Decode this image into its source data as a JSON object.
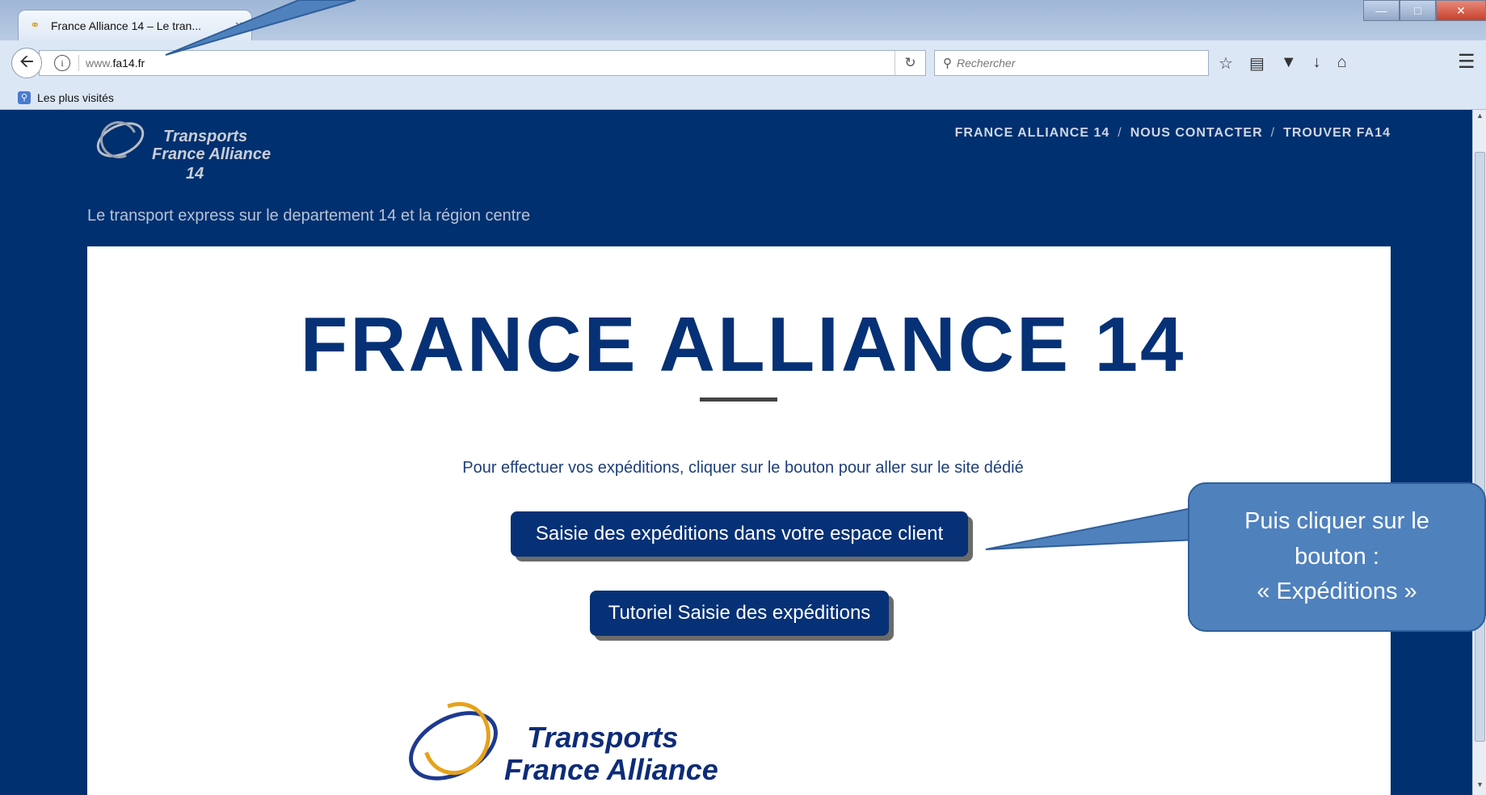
{
  "browser": {
    "tab_title": "France Alliance 14 – Le tran...",
    "url_prefix": "www.",
    "url_host": "fa14.fr",
    "search_placeholder": "Rechercher",
    "bookmark_label": "Les plus visités",
    "icons": {
      "tab_favicon": "logo-icon",
      "tab_close": "close-icon",
      "new_tab": "plus-icon",
      "back": "back-arrow-icon",
      "site_info": "info-icon",
      "reload": "reload-icon",
      "search": "search-icon",
      "bookmark_star": "star-icon",
      "reading_list": "library-icon",
      "pocket": "pocket-icon",
      "downloads": "download-icon",
      "home": "home-icon",
      "menu": "hamburger-menu-icon"
    }
  },
  "site": {
    "logo": {
      "line1": "Transports",
      "line2": "France Alliance",
      "line3": "14"
    },
    "nav": {
      "item1": "FRANCE ALLIANCE 14",
      "item2": "NOUS CONTACTER",
      "item3": "TROUVER FA14",
      "separator": "/"
    },
    "tagline": "Le transport express sur le departement 14 et la région centre",
    "hero_title": "FRANCE ALLIANCE 14",
    "intro": "Pour effectuer vos expéditions, cliquer sur le bouton pour aller sur le site dédié",
    "buttons": {
      "primary": "Saisie des expéditions dans votre espace client",
      "secondary": "Tutoriel Saisie des expéditions"
    },
    "footer_logo": {
      "line1": "Transports",
      "line2": "France Alliance"
    }
  },
  "annotation": {
    "callout_text": "Puis cliquer sur le bouton :\n« Expéditions »"
  },
  "colors": {
    "page_background": "#003070",
    "brand_navy": "#063176",
    "callout_blue": "#4f81bd",
    "logo_gold": "#e6a219"
  }
}
